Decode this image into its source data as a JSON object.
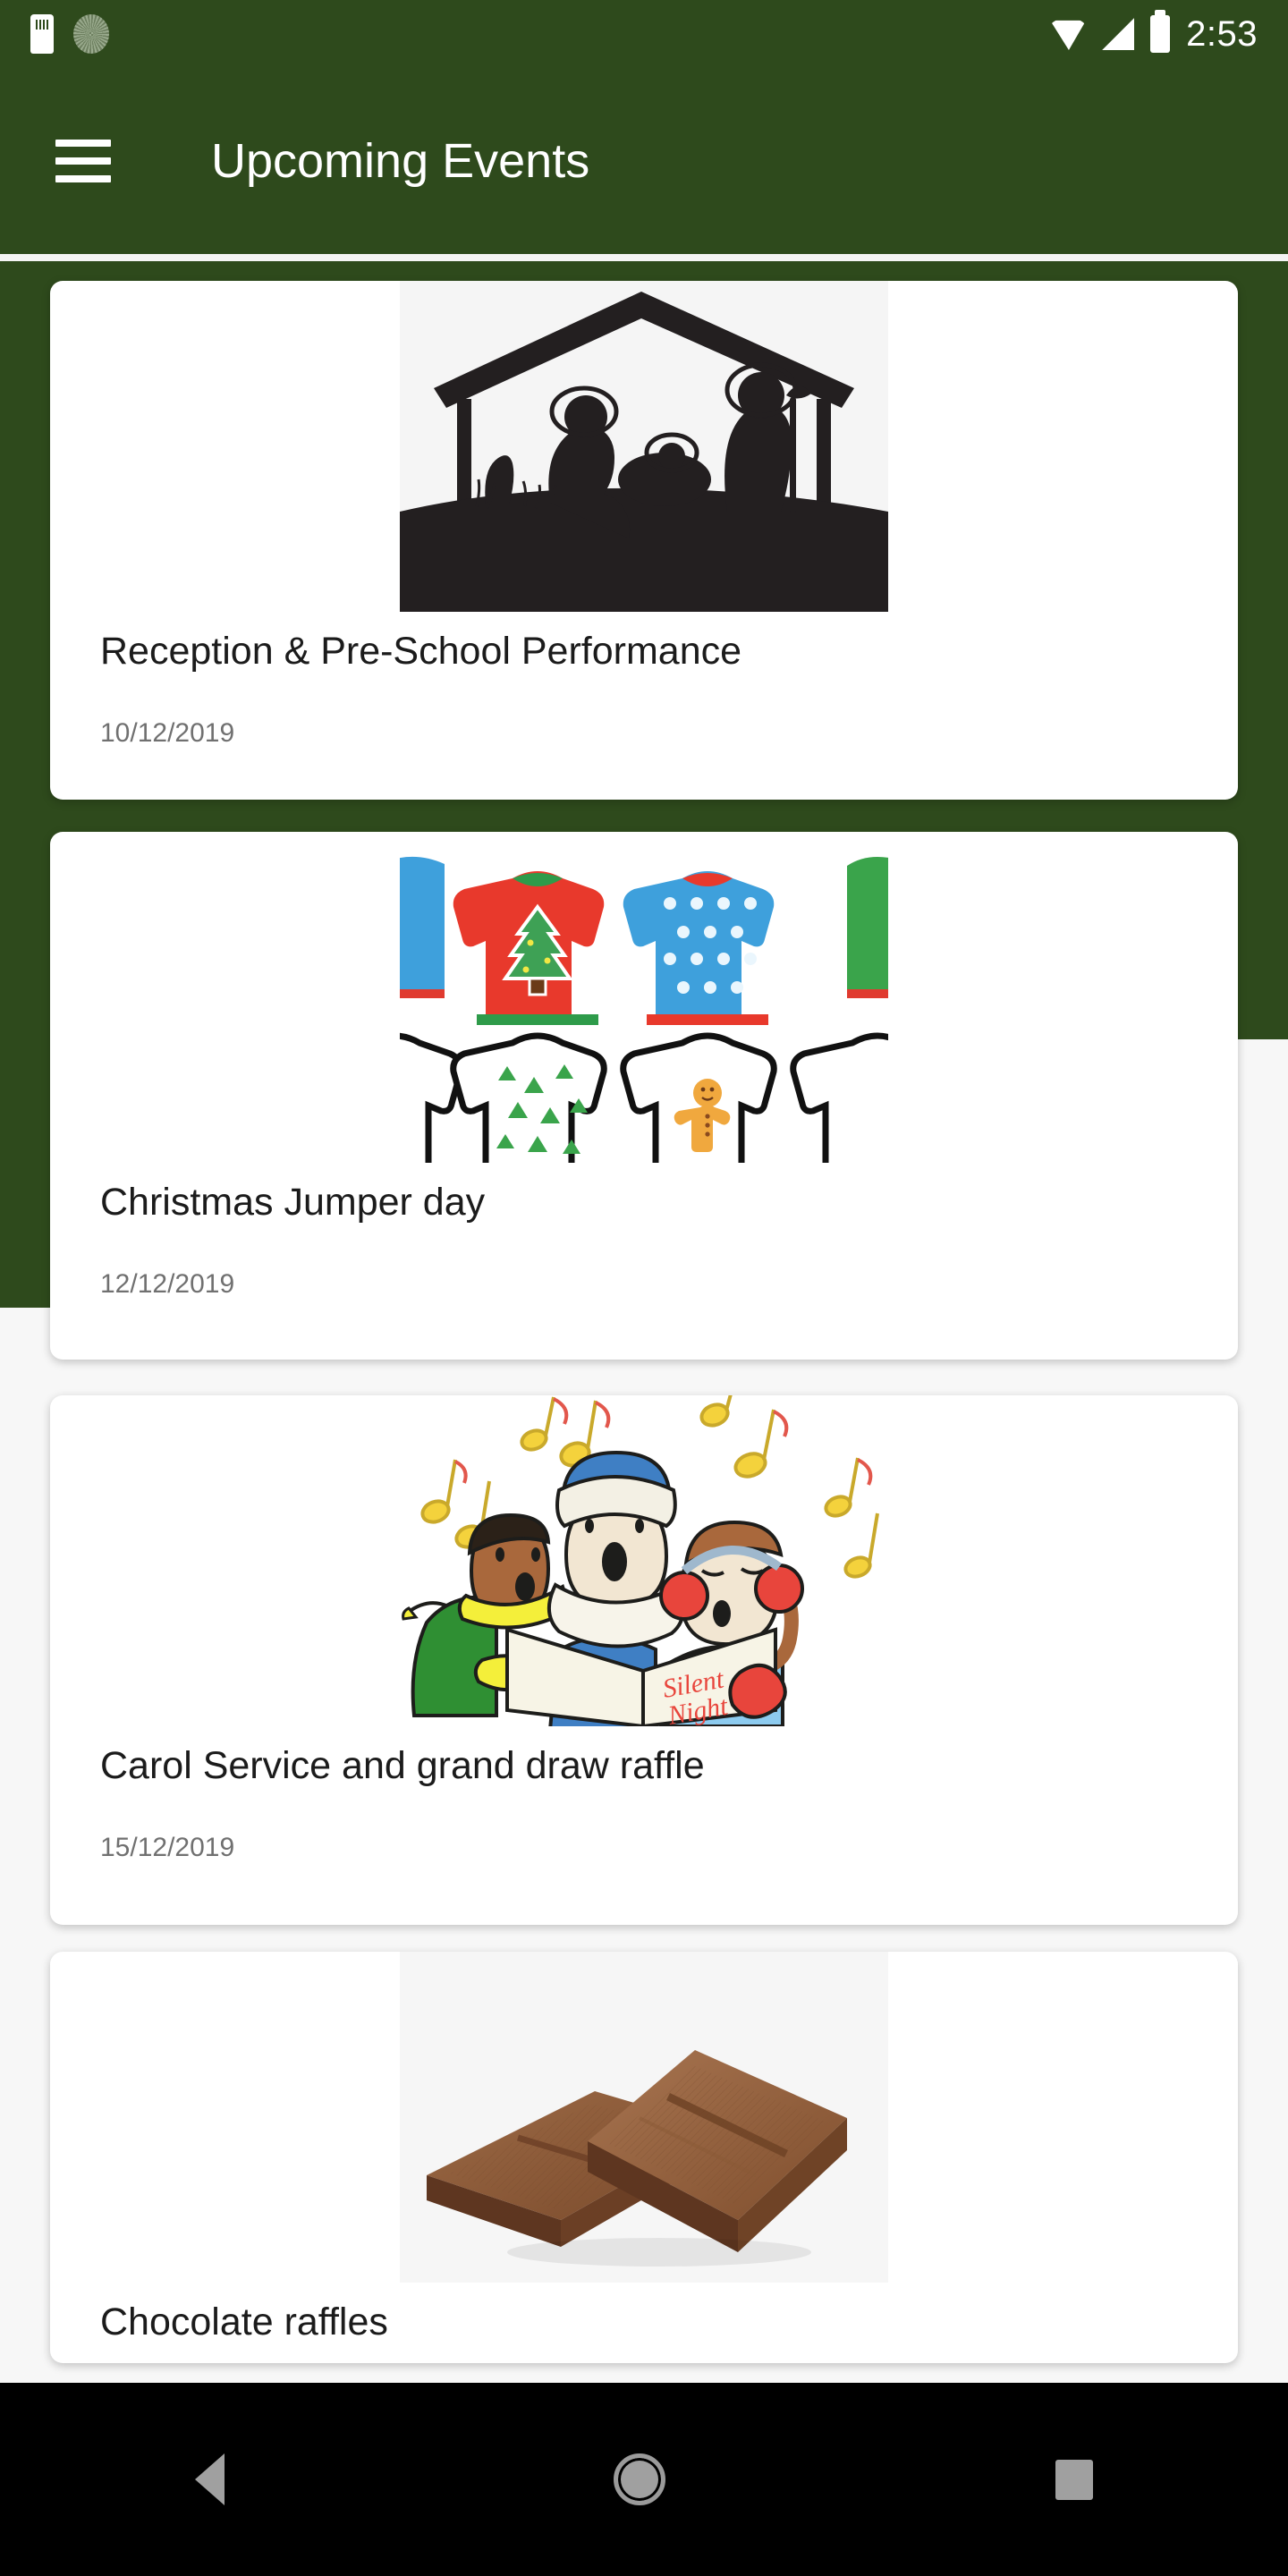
{
  "status_bar": {
    "time": "2:53",
    "icons": [
      "sd-card-icon",
      "sync-icon",
      "wifi-icon",
      "signal-icon",
      "battery-icon"
    ]
  },
  "app_bar": {
    "menu_icon": "hamburger-menu-icon",
    "title": "Upcoming Events"
  },
  "theme": {
    "primary_green": "#2e4a1c",
    "page_background": "#f7f7f7",
    "card_background": "#ffffff",
    "title_color": "#1b1b1b",
    "date_color": "#707070"
  },
  "events": [
    {
      "title": "Reception & Pre-School Performance",
      "date": "10/12/2019",
      "image": "nativity-silhouette-image"
    },
    {
      "title": "Christmas Jumper day",
      "date": "12/12/2019",
      "image": "christmas-jumpers-image"
    },
    {
      "title": "Carol Service and grand draw raffle",
      "date": "15/12/2019",
      "image": "carol-singers-image"
    },
    {
      "title": "Chocolate raffles",
      "date": "",
      "image": "chocolate-bars-image"
    }
  ],
  "nav_bar": {
    "back_label": "back-button",
    "home_label": "home-button",
    "recents_label": "recents-button"
  }
}
